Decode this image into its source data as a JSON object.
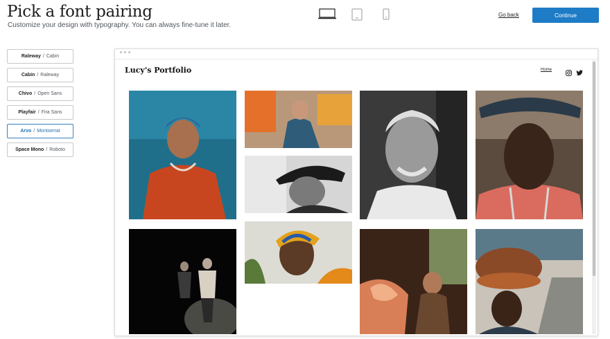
{
  "header": {
    "title": "Pick a font pairing",
    "subtitle": "Customize your design with typography. You can always fine-tune it later.",
    "go_back": "Go back",
    "continue": "Continue"
  },
  "devices": [
    "desktop-icon",
    "tablet-icon",
    "mobile-icon"
  ],
  "font_pairings": [
    {
      "heading": "Raleway",
      "body": "Cabin",
      "selected": false
    },
    {
      "heading": "Cabin",
      "body": "Raleway",
      "selected": false
    },
    {
      "heading": "Chivo",
      "body": "Open Sans",
      "selected": false
    },
    {
      "heading": "Playfair",
      "body": "Fira Sans",
      "selected": false
    },
    {
      "heading": "Arvo",
      "body": "Montserrat",
      "selected": true
    },
    {
      "heading": "Space Mono",
      "body": "Roboto",
      "selected": false
    }
  ],
  "separator": "/",
  "preview": {
    "site_title": "Lucy's Portfolio",
    "nav_home": "Home",
    "social_icons": [
      "instagram-icon",
      "twitter-icon"
    ]
  },
  "colors": {
    "accent": "#1e7bc6",
    "selected_border": "#3582c4"
  }
}
